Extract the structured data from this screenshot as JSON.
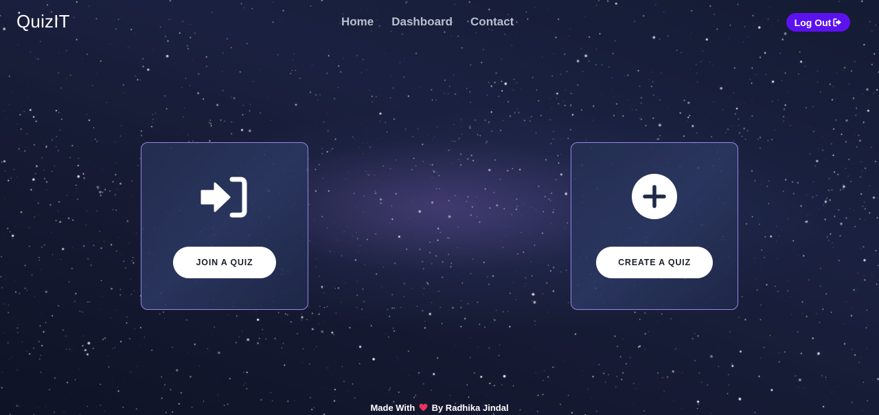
{
  "navbar": {
    "brand": "QuizIT",
    "links": [
      {
        "label": "Home"
      },
      {
        "label": "Dashboard"
      },
      {
        "label": "Contact"
      }
    ],
    "logout_label": "Log Out",
    "logout_icon": "sign-out-icon"
  },
  "cards": {
    "join": {
      "button_label": "JOIN A QUIZ",
      "icon": "sign-in-icon"
    },
    "create": {
      "button_label": "CREATE A QUIZ",
      "icon": "plus-circle-icon"
    }
  },
  "footer": {
    "prefix": "Made With",
    "icon": "heart-icon",
    "suffix": "By Radhika Jindal"
  },
  "colors": {
    "accent": "#5b12ee",
    "card_border": "#9b86ea",
    "heart": "#e8355e",
    "card_icon_dark": "#1f2a47"
  }
}
